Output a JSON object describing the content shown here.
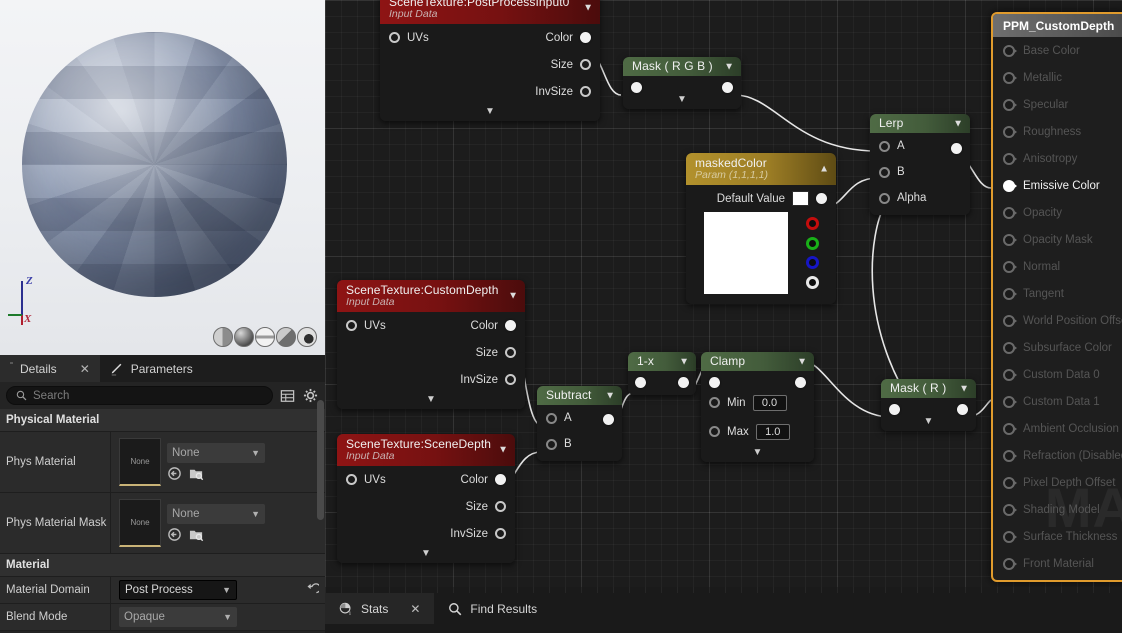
{
  "viewport": {
    "axis": {
      "z_label": "Z",
      "x_label": "X"
    },
    "shape_buttons": [
      {
        "name": "cylinder-preview"
      },
      {
        "name": "sphere-preview"
      },
      {
        "name": "plane-preview"
      },
      {
        "name": "cube-preview"
      },
      {
        "name": "custom-mesh-preview"
      }
    ]
  },
  "details": {
    "tabs": [
      {
        "label": "Details",
        "icon": "grip-icon",
        "active": true,
        "closable": true
      },
      {
        "label": "Parameters",
        "icon": "pencil-icon",
        "active": false,
        "closable": false
      }
    ],
    "search": {
      "placeholder": "Search",
      "value": "",
      "icon": "search-icon"
    },
    "header_icons": [
      "table-view-icon",
      "gear-icon"
    ],
    "sections": [
      {
        "title": "Physical Material",
        "rows": [
          {
            "name": "Phys Material",
            "thumb_label": "None",
            "combo_value": "None",
            "combo_enabled": false
          },
          {
            "name": "Phys Material Mask",
            "thumb_label": "None",
            "combo_value": "None",
            "combo_enabled": false
          }
        ]
      },
      {
        "title": "Material",
        "rows": [
          {
            "name": "Material Domain",
            "combo_value": "Post Process",
            "combo_enabled": true,
            "reset": true
          },
          {
            "name": "Blend Mode",
            "combo_value": "Opaque",
            "combo_enabled": false
          }
        ]
      }
    ]
  },
  "graph": {
    "nodes": [
      {
        "id": "scenetexture-postprocessinput0",
        "title": "SceneTexture:PostProcessInput0",
        "subtitle": "Input Data",
        "header_color": "#8e1414",
        "inputs": [
          {
            "label": "UVs",
            "state": "hollow"
          }
        ],
        "outputs": [
          {
            "label": "Color",
            "state": "filled"
          },
          {
            "label": "Size",
            "state": "hollow"
          },
          {
            "label": "InvSize",
            "state": "hollow"
          }
        ]
      },
      {
        "id": "mask-rgb",
        "title": "Mask ( R G B )",
        "header_color": "#4f6b45",
        "inputs": [
          {
            "label": "",
            "state": "filled"
          }
        ],
        "outputs": [
          {
            "label": "",
            "state": "filled"
          }
        ]
      },
      {
        "id": "maskedcolor",
        "title": "maskedColor",
        "subtitle": "Param (1,1,1,1)",
        "header_color": "#b2912c",
        "default_value_label": "Default Value",
        "default_value_color": "#ffffff",
        "swatch_color": "#ffffff",
        "channels": [
          {
            "name": "rgba-output",
            "color": "#ffffff"
          },
          {
            "name": "r-output",
            "color": "#c40d0d"
          },
          {
            "name": "g-output",
            "color": "#19b018"
          },
          {
            "name": "b-output",
            "color": "#1616c4"
          },
          {
            "name": "a-output",
            "color": "#e8e8e8"
          }
        ]
      },
      {
        "id": "lerp",
        "title": "Lerp",
        "header_color": "#4f6b45",
        "inputs": [
          {
            "label": "A",
            "state": "hollow"
          },
          {
            "label": "B",
            "state": "hollow"
          },
          {
            "label": "Alpha",
            "state": "hollow"
          }
        ],
        "outputs": [
          {
            "label": "",
            "state": "filled"
          }
        ]
      },
      {
        "id": "scenetexture-customdepth",
        "title": "SceneTexture:CustomDepth",
        "subtitle": "Input Data",
        "header_color": "#8e1414",
        "inputs": [
          {
            "label": "UVs",
            "state": "hollow"
          }
        ],
        "outputs": [
          {
            "label": "Color",
            "state": "filled"
          },
          {
            "label": "Size",
            "state": "hollow"
          },
          {
            "label": "InvSize",
            "state": "hollow"
          }
        ]
      },
      {
        "id": "scenetexture-scenedepth",
        "title": "SceneTexture:SceneDepth",
        "subtitle": "Input Data",
        "header_color": "#8e1414",
        "inputs": [
          {
            "label": "UVs",
            "state": "hollow"
          }
        ],
        "outputs": [
          {
            "label": "Color",
            "state": "filled"
          },
          {
            "label": "Size",
            "state": "hollow"
          },
          {
            "label": "InvSize",
            "state": "hollow"
          }
        ]
      },
      {
        "id": "subtract",
        "title": "Subtract",
        "header_color": "#4f6b45",
        "inputs": [
          {
            "label": "A",
            "state": "hollow"
          },
          {
            "label": "B",
            "state": "hollow"
          }
        ],
        "outputs": [
          {
            "label": "",
            "state": "filled"
          }
        ]
      },
      {
        "id": "one-minus-x",
        "title": "1-x",
        "header_color": "#4f6b45",
        "inputs": [
          {
            "label": "",
            "state": "filled"
          }
        ],
        "outputs": [
          {
            "label": "",
            "state": "filled"
          }
        ]
      },
      {
        "id": "clamp",
        "title": "Clamp",
        "header_color": "#4f6b45",
        "inputs": [
          {
            "label": "",
            "state": "filled"
          }
        ],
        "outputs": [
          {
            "label": "",
            "state": "filled"
          }
        ],
        "params": [
          {
            "label": "Min",
            "value": "0.0"
          },
          {
            "label": "Max",
            "value": "1.0"
          }
        ]
      },
      {
        "id": "mask-r",
        "title": "Mask ( R )",
        "header_color": "#4f6b45",
        "inputs": [
          {
            "label": "",
            "state": "filled"
          }
        ],
        "outputs": [
          {
            "label": "",
            "state": "filled"
          }
        ]
      }
    ]
  },
  "material_output": {
    "title": "PPM_CustomDepth",
    "border_color": "#e09b2d",
    "watermark": "MA",
    "pins": [
      {
        "label": "Base Color",
        "connected": false
      },
      {
        "label": "Metallic",
        "connected": false
      },
      {
        "label": "Specular",
        "connected": false
      },
      {
        "label": "Roughness",
        "connected": false
      },
      {
        "label": "Anisotropy",
        "connected": false
      },
      {
        "label": "Emissive Color",
        "connected": true
      },
      {
        "label": "Opacity",
        "connected": false
      },
      {
        "label": "Opacity Mask",
        "connected": false
      },
      {
        "label": "Normal",
        "connected": false
      },
      {
        "label": "Tangent",
        "connected": false
      },
      {
        "label": "World Position Offset",
        "connected": false
      },
      {
        "label": "Subsurface Color",
        "connected": false
      },
      {
        "label": "Custom Data 0",
        "connected": false
      },
      {
        "label": "Custom Data 1",
        "connected": false
      },
      {
        "label": "Ambient Occlusion",
        "connected": false
      },
      {
        "label": "Refraction (Disabled)",
        "connected": false
      },
      {
        "label": "Pixel Depth Offset",
        "connected": false
      },
      {
        "label": "Shading Model",
        "connected": false
      },
      {
        "label": "Surface Thickness",
        "connected": false
      },
      {
        "label": "Front Material",
        "connected": false
      }
    ]
  },
  "bottom_tabs": [
    {
      "label": "Stats",
      "icon": "stats-icon",
      "active": true,
      "closable": true
    },
    {
      "label": "Find Results",
      "icon": "search-icon",
      "active": false,
      "closable": false
    }
  ]
}
